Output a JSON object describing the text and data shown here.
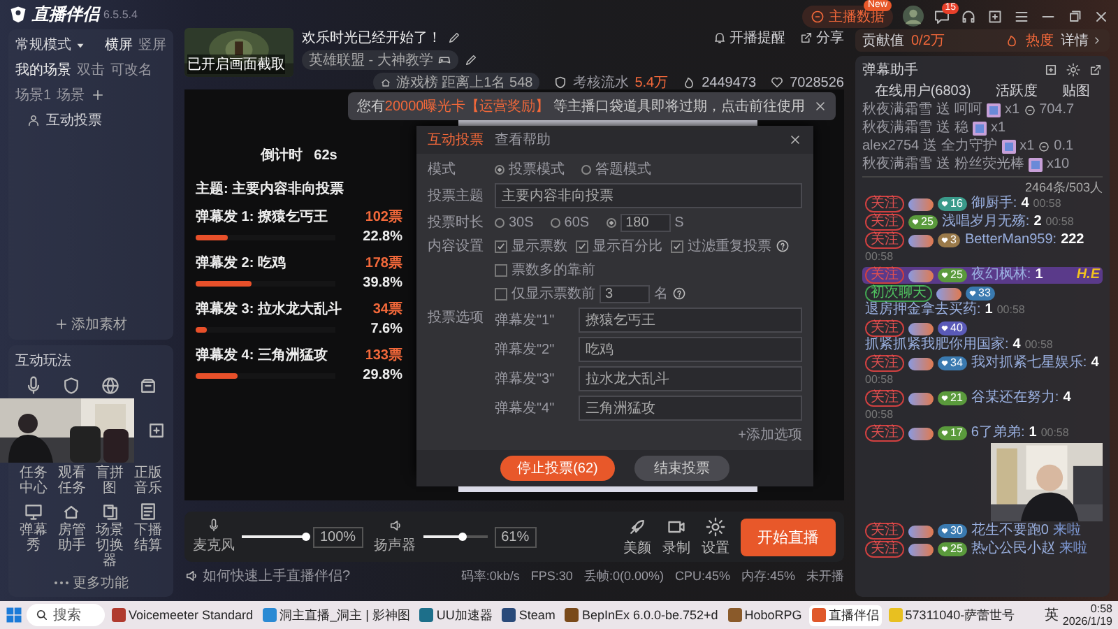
{
  "app": {
    "name": "直播伴侣",
    "version": "6.5.5.4"
  },
  "topbar": {
    "data_button": "主播数据",
    "new_badge": "New",
    "message_count": "15"
  },
  "scene_panel": {
    "mode": "常规模式",
    "orientations": [
      {
        "label": "横屏",
        "selected": true
      },
      {
        "label": "竖屏",
        "selected": false
      }
    ],
    "scene_tabs": [
      {
        "label": "我的场景",
        "selected": true
      },
      {
        "label": "双击",
        "selected": false
      },
      {
        "label": "可改名",
        "selected": false
      },
      {
        "label": "场景1",
        "selected": false
      },
      {
        "label": "场景",
        "selected": false
      }
    ],
    "sources": [
      "互动投票"
    ],
    "add_source": "添加素材"
  },
  "interact_panel": {
    "title": "互动玩法",
    "row_labels": [
      "任务中心",
      "观看任务",
      "盲拼图",
      "正版音乐"
    ],
    "tools": [
      "弹幕秀",
      "房管助手",
      "场景切换器",
      "下播结算"
    ],
    "more": "更多功能"
  },
  "header": {
    "thumbnail_caption": "已开启画面截取",
    "title": "欢乐时光已经开始了！",
    "category": "英雄联盟 - 大神教学",
    "remind": "开播提醒",
    "share": "分享",
    "rank_label": "游戏榜",
    "rank_gap": "距离上1名 548",
    "assessment_label": "考核流水",
    "assessment_value": "5.4万",
    "popularity": "2449473",
    "likes": "7028526"
  },
  "toast": {
    "segments": [
      {
        "text": "您有",
        "highlight": false
      },
      {
        "text": "20000曝光卡",
        "highlight": true
      },
      {
        "text": "【运营奖励】",
        "highlight": true
      },
      {
        "text": " 等主播口袋道具即将过期，点击前往使用",
        "highlight": false
      }
    ]
  },
  "vote_overlay": {
    "countdown_label": "倒计时",
    "countdown": "62s",
    "topic": "主题: 主要内容非向投票",
    "options": [
      {
        "label": "弹幕发 1: 撩猿乞丐王",
        "votes": "102票",
        "percent": "22.8%",
        "level": 0.228
      },
      {
        "label": "弹幕发 2: 吃鸡",
        "votes": "178票",
        "percent": "39.8%",
        "level": 0.398
      },
      {
        "label": "弹幕发 3: 拉水龙大乱斗",
        "votes": "34票",
        "percent": "7.6%",
        "level": 0.076
      },
      {
        "label": "弹幕发 4: 三角洲猛攻",
        "votes": "133票",
        "percent": "29.8%",
        "level": 0.298
      }
    ]
  },
  "modal": {
    "tabs": [
      {
        "label": "互动投票",
        "selected": true
      },
      {
        "label": "查看帮助",
        "selected": false
      }
    ],
    "mode_label": "模式",
    "modes": [
      {
        "label": "投票模式",
        "selected": true
      },
      {
        "label": "答题模式",
        "selected": false
      }
    ],
    "topic_label": "投票主题",
    "topic": "主要内容非向投票",
    "duration_label": "投票时长",
    "durations": [
      {
        "kind": "preset",
        "label": "30S",
        "selected": false
      },
      {
        "kind": "preset",
        "label": "60S",
        "selected": false
      },
      {
        "kind": "custom",
        "label": "180",
        "unit": "S",
        "selected": true
      }
    ],
    "content_label": "内容设置",
    "content_options": [
      {
        "label": "显示票数",
        "checked": true,
        "help": false
      },
      {
        "label": "显示百分比",
        "checked": true,
        "help": false
      },
      {
        "label": "过滤重复投票",
        "checked": true,
        "help": true
      },
      {
        "label": "票数多的靠前",
        "checked": false,
        "help": false
      },
      {
        "label": "仅显示票数前",
        "checked": false,
        "help": true,
        "count": "3",
        "unit": "名"
      }
    ],
    "options_label": "投票选项",
    "options": [
      {
        "prefix": "弹幕发\"1\"",
        "value": "撩猿乞丐王"
      },
      {
        "prefix": "弹幕发\"2\"",
        "value": "吃鸡"
      },
      {
        "prefix": "弹幕发\"3\"",
        "value": "拉水龙大乱斗"
      },
      {
        "prefix": "弹幕发\"4\"",
        "value": "三角洲猛攻"
      }
    ],
    "add_option": "+添加选项",
    "stop_button": "停止投票(62)",
    "end_button": "结束投票"
  },
  "audio": {
    "channels": [
      {
        "name": "麦克风",
        "level": 1,
        "reading": "100%"
      },
      {
        "name": "扬声器",
        "level": 0.61,
        "reading": "61%"
      }
    ],
    "tools": [
      "美颜",
      "录制",
      "设置"
    ],
    "start_button": "开始直播"
  },
  "status": {
    "help_tip": "如何快速上手直播伴侣?",
    "stats": [
      "码率:0kb/s",
      "FPS:30",
      "丢帧:0(0.00%)",
      "CPU:45%",
      "内存:45%",
      "未开播"
    ]
  },
  "contribution": {
    "label": "贡献值",
    "value": "0/2万",
    "heat": "热度",
    "details": "详情"
  },
  "danmu": {
    "title": "弹幕助手",
    "tabs": [
      "在线用户(6803)",
      "活跃度",
      "贴图"
    ],
    "gifts": [
      {
        "user": "秋夜满霜雪",
        "verb": "送",
        "gift": "呵呵",
        "count": "x1",
        "value": "704.7"
      },
      {
        "user": "秋夜满霜雪",
        "verb": "送",
        "gift": "稳",
        "count": "x1"
      },
      {
        "user": "alex2754",
        "verb": "送",
        "gift": "全力守护",
        "count": "x1",
        "value": "0.1"
      },
      {
        "user": "秋夜满霜雪",
        "verb": "送",
        "gift": "粉丝荧光棒",
        "count": "x10"
      }
    ],
    "summary": "2464条/503人",
    "messages": [
      {
        "kind": "chat",
        "tag": {
          "kind": "follow",
          "label": "关注"
        },
        "fan": true,
        "level": "16",
        "color": "#3a9a8a",
        "user": "御厨手:",
        "text": "4",
        "time": "00:58",
        "highlighted": false
      },
      {
        "kind": "chat",
        "tag": {
          "kind": "follow",
          "label": "关注"
        },
        "fan": false,
        "level": "25",
        "color": "#5a9a3c",
        "user": "浅唱岁月无殇:",
        "text": "2",
        "time": "00:58",
        "highlighted": false
      },
      {
        "kind": "chat",
        "tag": {
          "kind": "follow",
          "label": "关注"
        },
        "fan": true,
        "level": "3",
        "color": "#9a7a4a",
        "user": "BetterMan959:",
        "text": "222",
        "time": "00:58",
        "highlighted": false
      },
      {
        "kind": "chat",
        "tag": {
          "kind": "follow",
          "label": "关注"
        },
        "fan": true,
        "level": "25",
        "color": "#5a9a3c",
        "user": "夜幻枫林:",
        "text": "1",
        "highlighted": true,
        "badge_text": "H.E"
      },
      {
        "kind": "chat",
        "tag": {
          "kind": "first",
          "label": "初次聊天"
        },
        "fan": true,
        "level": "33",
        "color": "#3a7ab0",
        "user": "退房押金拿去买药:",
        "text": "1",
        "time": "00:58",
        "highlighted": false
      },
      {
        "kind": "chat",
        "tag": {
          "kind": "follow",
          "label": "关注"
        },
        "fan": true,
        "level": "40",
        "color": "#5a5ab8",
        "user": "抓紧抓紧我肥你用国家:",
        "text": "4",
        "time": "00:58",
        "highlighted": false
      },
      {
        "kind": "chat",
        "tag": {
          "kind": "follow",
          "label": "关注"
        },
        "fan": true,
        "level": "34",
        "color": "#3a7ab0",
        "user": "我对抓紧七星娱乐:",
        "text": "4",
        "time": "00:58",
        "highlighted": false
      },
      {
        "kind": "chat",
        "tag": {
          "kind": "follow",
          "label": "关注"
        },
        "fan": true,
        "level": "21",
        "color": "#5a9a3c",
        "user": "谷某还在努力:",
        "text": "4",
        "time": "00:58",
        "highlighted": false
      },
      {
        "kind": "chat",
        "tag": {
          "kind": "follow",
          "label": "关注"
        },
        "fan": true,
        "level": "17",
        "color": "#5a9a3c",
        "user": "6了弟弟:",
        "text": "1",
        "time": "00:58",
        "highlighted": false
      }
    ],
    "later_messages": [
      {
        "kind": "enter",
        "tag": {
          "kind": "follow",
          "label": "关注"
        },
        "fan": true,
        "level": "30",
        "color": "#3a7ab0",
        "user": "花生不要跑0",
        "text": "来啦",
        "highlighted": false
      },
      {
        "kind": "enter",
        "tag": {
          "kind": "follow",
          "label": "关注"
        },
        "fan": true,
        "level": "25",
        "color": "#5a9a3c",
        "user": "热心公民小赵",
        "text": "来啦",
        "highlighted": false
      }
    ]
  },
  "taskbar": {
    "search": "搜索",
    "apps": [
      {
        "label": "Voicemeeter Standard",
        "selected": false
      },
      {
        "label": "洞主直播_洞主 | 影神图",
        "selected": false
      },
      {
        "label": "UU加速器",
        "selected": false
      },
      {
        "label": "Steam",
        "selected": false
      },
      {
        "label": "BepInEx 6.0.0-be.752+d",
        "selected": false
      },
      {
        "label": "HoboRPG",
        "selected": false
      },
      {
        "label": "直播伴侣",
        "selected": true
      },
      {
        "label": "57311040-萨蕾世号",
        "selected": false
      }
    ],
    "ime": "英",
    "time": "0:58",
    "date": "2026/1/19"
  }
}
